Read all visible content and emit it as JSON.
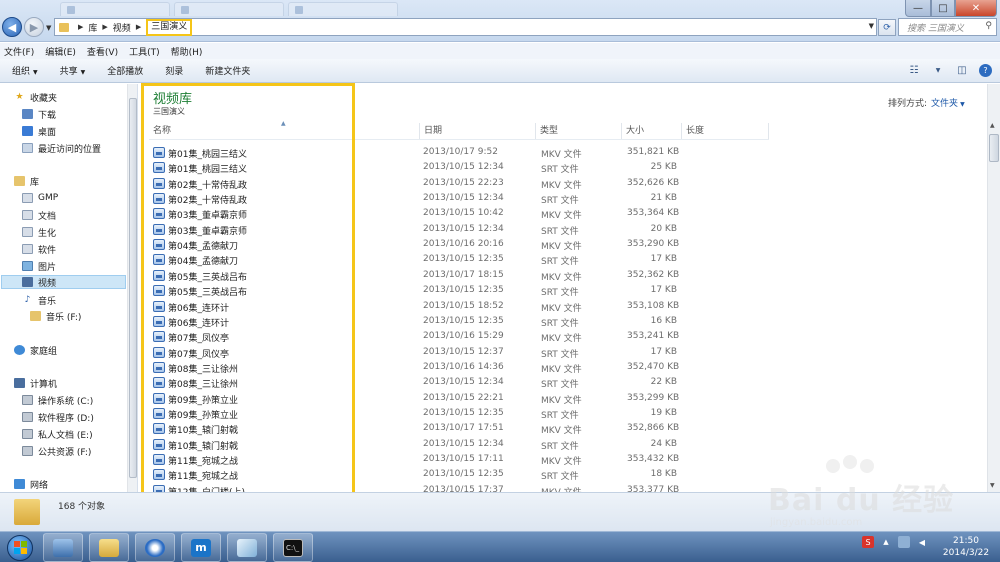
{
  "window": {
    "tabs": [
      "",
      "",
      ""
    ],
    "controls": {
      "minimize": "—",
      "maximize": "□",
      "close": "✕"
    }
  },
  "address": {
    "crumbs": [
      "库",
      "视频",
      "三国演义"
    ],
    "search_placeholder": "搜索 三国演义"
  },
  "menu": [
    "文件(F)",
    "编辑(E)",
    "查看(V)",
    "工具(T)",
    "帮助(H)"
  ],
  "toolbar": {
    "organize": "组织",
    "share": "共享",
    "play_all": "全部播放",
    "burn": "刻录",
    "new_folder": "新建文件夹"
  },
  "sidebar": {
    "favorites": "收藏夹",
    "favorites_items": [
      "下载",
      "桌面",
      "最近访问的位置"
    ],
    "libraries": "库",
    "library_items": [
      "GMP",
      "文档",
      "生化",
      "软件",
      "图片",
      "视频",
      "音乐"
    ],
    "music_sub": "音乐 (F:)",
    "homegroup": "家庭组",
    "computer": "计算机",
    "drives": [
      "操作系统 (C:)",
      "软件程序 (D:)",
      "私人文档 (E:)",
      "公共资源 (F:)"
    ],
    "network": "网络",
    "selected": "视频"
  },
  "content": {
    "library_title": "视频库",
    "library_subtitle": "三国演义",
    "arrange_label": "排列方式:",
    "arrange_value": "文件夹",
    "columns": [
      "名称",
      "日期",
      "类型",
      "大小",
      "长度"
    ],
    "files": [
      {
        "name": "第01集_桃园三结义",
        "date": "2013/10/17 9:52",
        "type": "MKV 文件",
        "size": "351,821 KB"
      },
      {
        "name": "第01集_桃园三结义",
        "date": "2013/10/15 12:34",
        "type": "SRT 文件",
        "size": "25 KB"
      },
      {
        "name": "第02集_十常侍乱政",
        "date": "2013/10/15 22:23",
        "type": "MKV 文件",
        "size": "352,626 KB"
      },
      {
        "name": "第02集_十常侍乱政",
        "date": "2013/10/15 12:34",
        "type": "SRT 文件",
        "size": "21 KB"
      },
      {
        "name": "第03集_董卓霸京师",
        "date": "2013/10/15 10:42",
        "type": "MKV 文件",
        "size": "353,364 KB"
      },
      {
        "name": "第03集_董卓霸京师",
        "date": "2013/10/15 12:34",
        "type": "SRT 文件",
        "size": "20 KB"
      },
      {
        "name": "第04集_孟德献刀",
        "date": "2013/10/16 20:16",
        "type": "MKV 文件",
        "size": "353,290 KB"
      },
      {
        "name": "第04集_孟德献刀",
        "date": "2013/10/15 12:35",
        "type": "SRT 文件",
        "size": "17 KB"
      },
      {
        "name": "第05集_三英战吕布",
        "date": "2013/10/17 18:15",
        "type": "MKV 文件",
        "size": "352,362 KB"
      },
      {
        "name": "第05集_三英战吕布",
        "date": "2013/10/15 12:35",
        "type": "SRT 文件",
        "size": "17 KB"
      },
      {
        "name": "第06集_连环计",
        "date": "2013/10/15 18:52",
        "type": "MKV 文件",
        "size": "353,108 KB"
      },
      {
        "name": "第06集_连环计",
        "date": "2013/10/15 12:35",
        "type": "SRT 文件",
        "size": "16 KB"
      },
      {
        "name": "第07集_凤仪亭",
        "date": "2013/10/16 15:29",
        "type": "MKV 文件",
        "size": "353,241 KB"
      },
      {
        "name": "第07集_凤仪亭",
        "date": "2013/10/15 12:37",
        "type": "SRT 文件",
        "size": "17 KB"
      },
      {
        "name": "第08集_三让徐州",
        "date": "2013/10/16 14:36",
        "type": "MKV 文件",
        "size": "352,470 KB"
      },
      {
        "name": "第08集_三让徐州",
        "date": "2013/10/15 12:34",
        "type": "SRT 文件",
        "size": "22 KB"
      },
      {
        "name": "第09集_孙策立业",
        "date": "2013/10/15 22:21",
        "type": "MKV 文件",
        "size": "353,299 KB"
      },
      {
        "name": "第09集_孙策立业",
        "date": "2013/10/15 12:35",
        "type": "SRT 文件",
        "size": "19 KB"
      },
      {
        "name": "第10集_辕门射戟",
        "date": "2013/10/17 17:51",
        "type": "MKV 文件",
        "size": "352,866 KB"
      },
      {
        "name": "第10集_辕门射戟",
        "date": "2013/10/15 12:34",
        "type": "SRT 文件",
        "size": "24 KB"
      },
      {
        "name": "第11集_宛城之战",
        "date": "2013/10/15 17:11",
        "type": "MKV 文件",
        "size": "353,432 KB"
      },
      {
        "name": "第11集_宛城之战",
        "date": "2013/10/15 12:35",
        "type": "SRT 文件",
        "size": "18 KB"
      },
      {
        "name": "第12集_白门楼(上)",
        "date": "2013/10/15 17:37",
        "type": "MKV 文件",
        "size": "353,377 KB"
      }
    ]
  },
  "status": {
    "count": "168 个对象"
  },
  "taskbar": {
    "clock_time": "21:50",
    "clock_date": "2014/3/22",
    "tray_badge": "S"
  },
  "watermark": {
    "main": "Bai du 经验",
    "sub": "jingyan.baidu.com"
  },
  "colors": {
    "highlight": "#f5c518",
    "library_title": "#1e7f35",
    "selection": "#cde6f7"
  }
}
